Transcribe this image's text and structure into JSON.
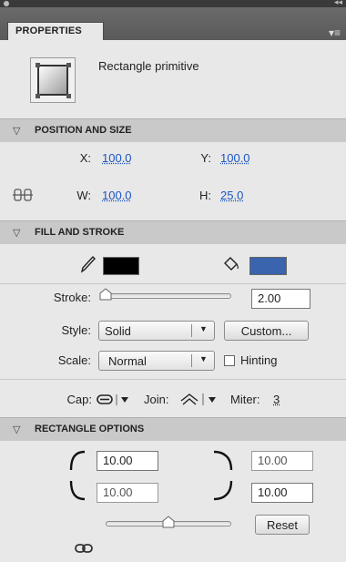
{
  "panel": {
    "tab_title": "PROPERTIES",
    "menu_icon": "panel-menu-icon"
  },
  "primitive": {
    "title": "Rectangle primitive",
    "icon": "rectangle-primitive-icon"
  },
  "position_size": {
    "header": "POSITION AND SIZE",
    "x_label": "X:",
    "x_value": "100.0",
    "y_label": "Y:",
    "y_value": "100.0",
    "w_label": "W:",
    "w_value": "100.0",
    "h_label": "H:",
    "h_value": "25.0",
    "lock_icon": "link-proportions-icon"
  },
  "fill_stroke": {
    "header": "FILL AND STROKE",
    "stroke_color": "#000000",
    "fill_color": "#3a64ad",
    "stroke_label": "Stroke:",
    "stroke_value": "2.00",
    "stroke_slider_fraction": 0.0,
    "style_label": "Style:",
    "style_value": "Solid",
    "custom_button": "Custom...",
    "scale_label": "Scale:",
    "scale_value": "Normal",
    "hinting_label": "Hinting",
    "hinting_checked": false,
    "cap_label": "Cap:",
    "join_label": "Join:",
    "miter_label": "Miter:",
    "miter_value": "3"
  },
  "rectangle_options": {
    "header": "RECTANGLE OPTIONS",
    "top_left": "10.00",
    "top_right": "10.00",
    "bottom_left": "10.00",
    "bottom_right": "10.00",
    "radius_slider_fraction": 0.5,
    "reset_button": "Reset"
  }
}
